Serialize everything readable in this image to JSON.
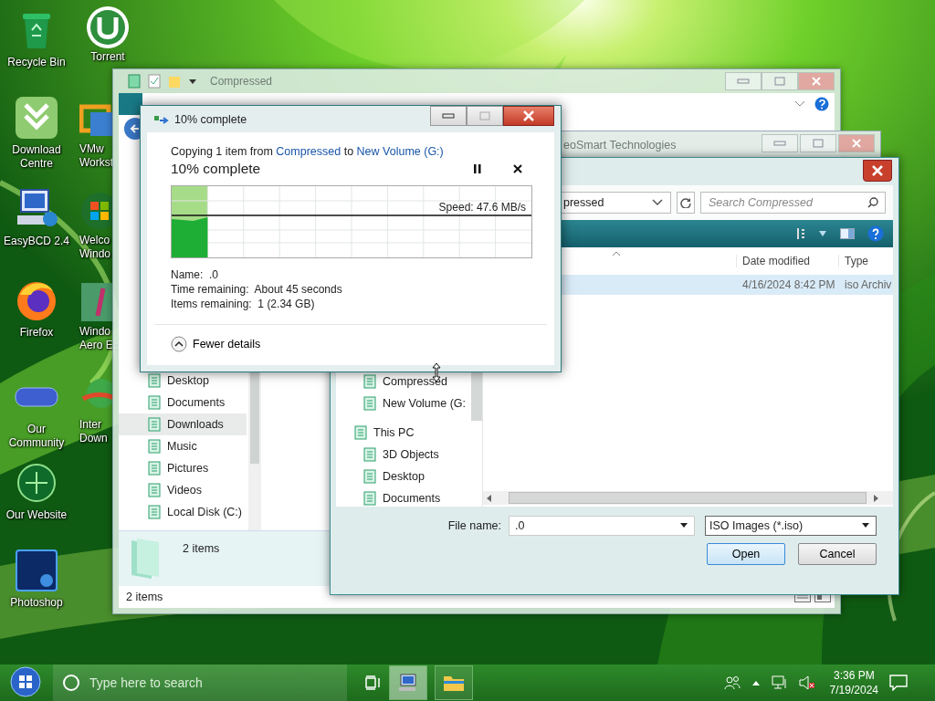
{
  "desktop": {
    "icons": [
      {
        "label": "Recycle Bin"
      },
      {
        "label": "Download Centre"
      },
      {
        "label": "EasyBCD 2.4"
      },
      {
        "label": "Firefox"
      },
      {
        "label": "Our Community"
      },
      {
        "label": "Our Website"
      },
      {
        "label": "Photoshop"
      }
    ],
    "partial_icons": [
      {
        "lines": [
          "Torrent"
        ]
      },
      {
        "lines": [
          "VMw",
          "Workst"
        ]
      },
      {
        "lines": [
          "Welco",
          "Windo"
        ]
      },
      {
        "lines": [
          "Windo",
          "Aero Ec"
        ]
      },
      {
        "lines": [
          "Inter",
          "Down"
        ]
      }
    ]
  },
  "explorer_window": {
    "title": "Compressed",
    "nav_items": [
      {
        "label": "Desktop",
        "selected": false
      },
      {
        "label": "Documents",
        "selected": false
      },
      {
        "label": "Downloads",
        "selected": true
      },
      {
        "label": "Music",
        "selected": false
      },
      {
        "label": "Pictures",
        "selected": false
      },
      {
        "label": "Videos",
        "selected": false
      },
      {
        "label": "Local Disk (C:)",
        "selected": false
      }
    ],
    "details_count": "2 items",
    "status_bar": "2 items"
  },
  "background_window": {
    "title": "eoSmart Technologies"
  },
  "open_dialog": {
    "address": "pressed",
    "search": {
      "placeholder": "Search Compressed"
    },
    "columns": [
      "Date modified",
      "Type"
    ],
    "rows": [
      {
        "date_modified": "4/16/2024 8:42 PM",
        "type": "iso Archiv",
        "selected": true
      }
    ],
    "nav_items": [
      {
        "label": "Compressed",
        "kind": "child"
      },
      {
        "label": "New Volume (G:",
        "kind": "child"
      },
      {
        "label": "This PC",
        "kind": "root"
      },
      {
        "label": "3D Objects",
        "kind": "child"
      },
      {
        "label": "Desktop",
        "kind": "child"
      },
      {
        "label": "Documents",
        "kind": "child"
      }
    ],
    "file_name_label": "File name:",
    "file_name": ".0",
    "file_type": "ISO Images (*.iso)",
    "buttons": [
      "Open",
      "Cancel"
    ]
  },
  "copy_dialog": {
    "title": "10% complete",
    "sentence": {
      "prefix": "Copying 1 item from",
      "source": "Compressed",
      "middle": "to",
      "destination": "New Volume (G:)"
    },
    "heading": "10% complete",
    "progress": {
      "level": 0.1
    },
    "speed": "Speed: 47.6 MB/s",
    "details": [
      {
        "label": "Name:",
        "value": ".0"
      },
      {
        "label": "Time remaining:",
        "value": "About 45 seconds"
      },
      {
        "label": "Items remaining:",
        "value": "1 (2.34 GB)"
      }
    ],
    "toggle": "Fewer details"
  },
  "taskbar": {
    "search": {
      "placeholder": "Type here to search"
    },
    "apps": [
      {
        "active": true
      },
      {
        "active": false
      }
    ],
    "time": "3:36 PM",
    "date": "7/19/2024"
  }
}
